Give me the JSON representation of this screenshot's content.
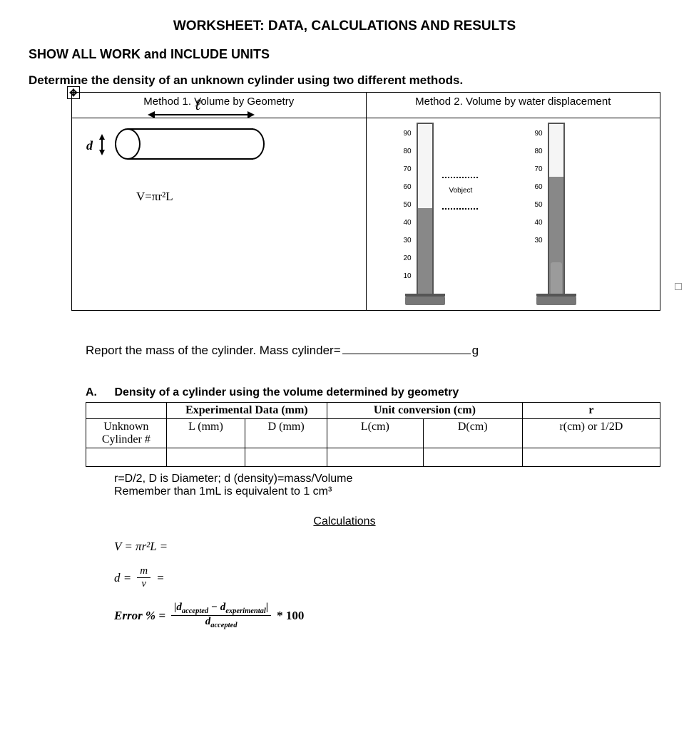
{
  "title": "WORKSHEET:  DATA, CALCULATIONS AND RESULTS",
  "sub1": "SHOW ALL WORK and INCLUDE UNITS",
  "sub2": "Determine the density of an unknown cylinder using two different methods.",
  "methods": {
    "m1": "Method 1.  Volume by Geometry",
    "m2": "Method 2.  Volume by water displacement",
    "l_label": "ℓ",
    "d_label": "d",
    "v_eq": "V=πr²L",
    "vobject": "Vobject",
    "tick_labels": [
      "90",
      "80",
      "70",
      "60",
      "50",
      "40",
      "30",
      "20",
      "10"
    ]
  },
  "mass": {
    "prompt": "Report the mass of the cylinder.   Mass cylinder=",
    "unit": "g"
  },
  "sectionA": {
    "label": "A.",
    "title": "Density of a cylinder using the volume determined by geometry",
    "h_exp": "Experimental Data (mm)",
    "h_unit": "Unit conversion (cm)",
    "h_r": "r",
    "c_unk": "Unknown Cylinder #",
    "c_Lmm": "L (mm)",
    "c_Dmm": "D (mm)",
    "c_Lcm": "L(cm)",
    "c_Dcm": "D(cm)",
    "c_r": "r(cm) or 1/2D"
  },
  "notes": {
    "l1": "r=D/2, D is Diameter; d (density)=mass/Volume",
    "l2": "Remember than 1mL is equivalent to 1 cm³"
  },
  "calc_h": "Calculations",
  "eq": {
    "v": "V = πr²L =",
    "d_lhs": "d =",
    "d_frac_n": "m",
    "d_frac_d": "v",
    "d_eq": "=",
    "err_lhs": "Error % =",
    "err_n_html": "|d<sub>accepted</sub> − d<sub>experimental</sub>|",
    "err_d_html": "d<sub>accepted</sub>",
    "err_tail": "* 100"
  }
}
